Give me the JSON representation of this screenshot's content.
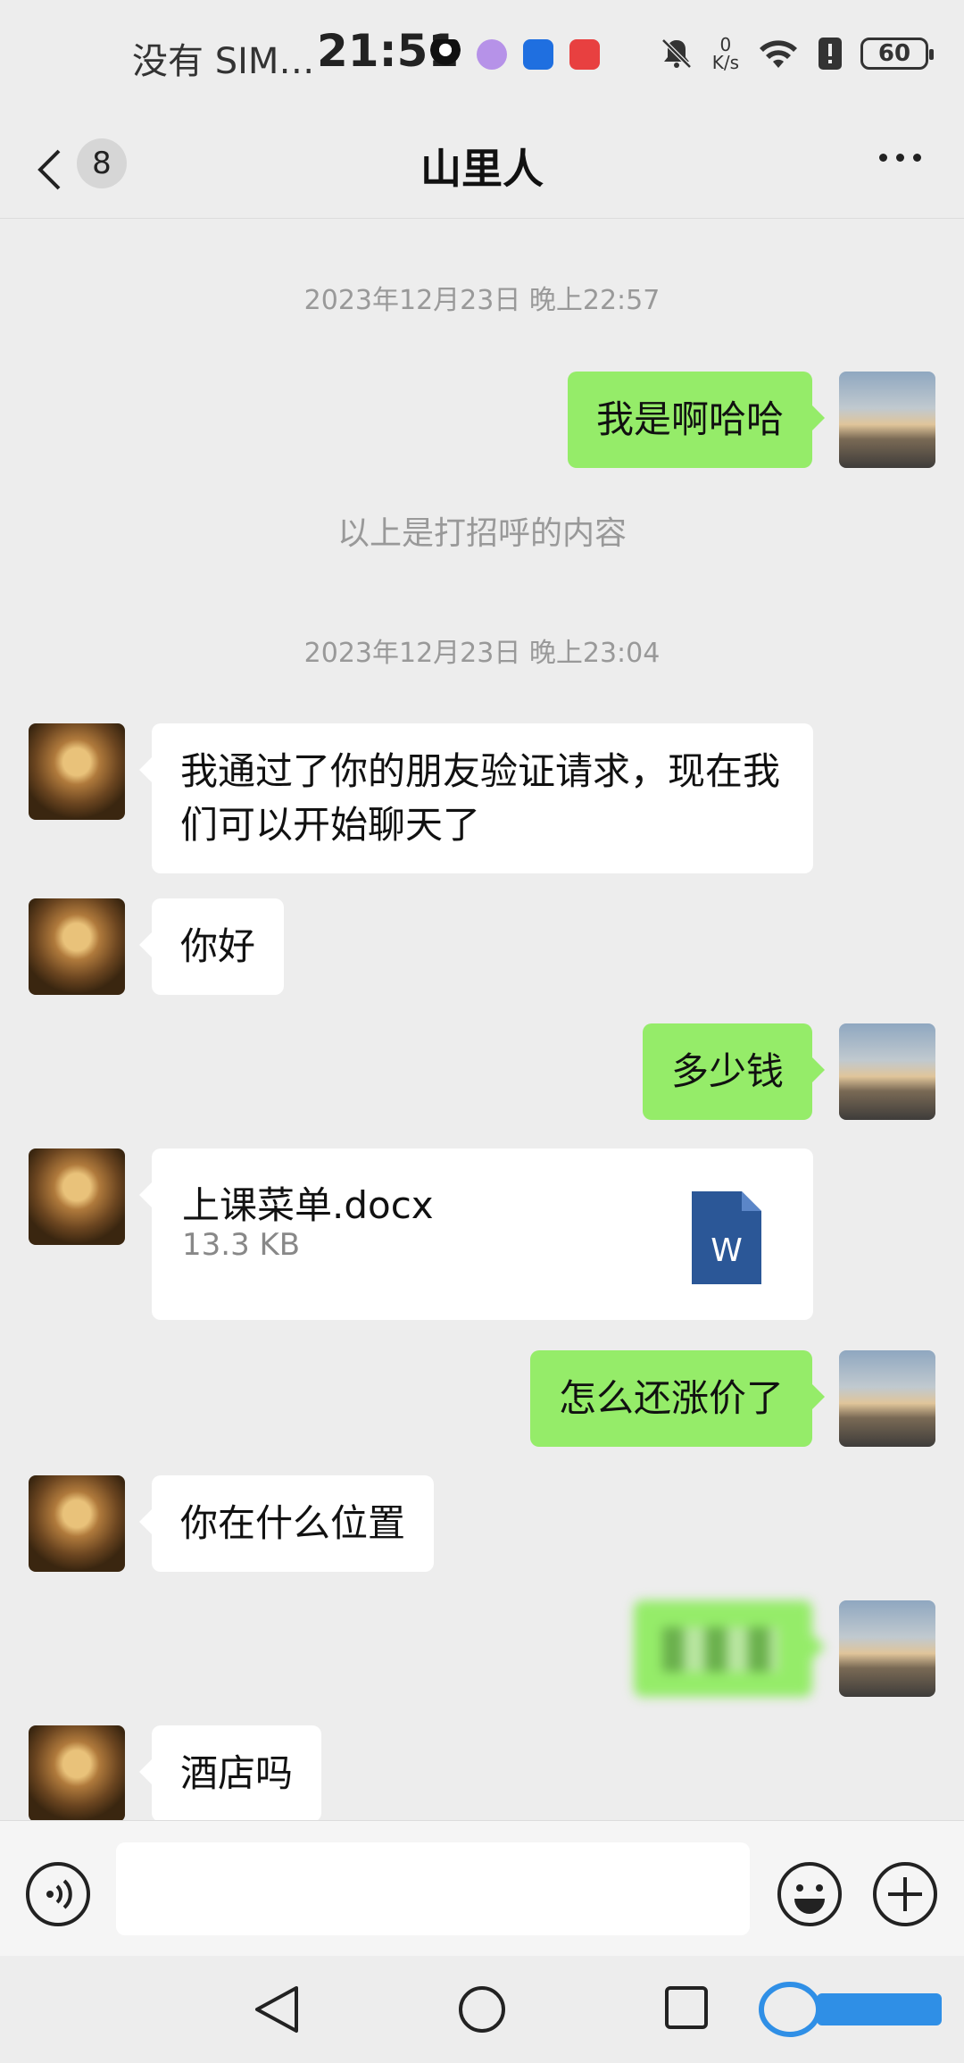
{
  "status_bar": {
    "carrier": "没有 SIM…",
    "time": "21:51",
    "net_speed_value": "0",
    "net_speed_unit": "K/s",
    "battery": "60"
  },
  "header": {
    "unread_count": "8",
    "title": "山里人"
  },
  "messages": [
    {
      "type": "timestamp",
      "text": "2023年12月23日 晚上22:57"
    },
    {
      "type": "outgoing",
      "text": "我是啊哈哈"
    },
    {
      "type": "system",
      "text": "以上是打招呼的内容"
    },
    {
      "type": "timestamp",
      "text": "2023年12月23日 晚上23:04"
    },
    {
      "type": "incoming",
      "text": "我通过了你的朋友验证请求，现在我们可以开始聊天了"
    },
    {
      "type": "incoming",
      "text": "你好"
    },
    {
      "type": "outgoing",
      "text": "多少钱"
    },
    {
      "type": "incoming_file",
      "file_name": "上课菜单.docx",
      "file_size": "13.3 KB",
      "file_icon_letter": "W"
    },
    {
      "type": "outgoing",
      "text": "怎么还涨价了"
    },
    {
      "type": "incoming",
      "text": "你在什么位置"
    },
    {
      "type": "outgoing_blurred"
    },
    {
      "type": "incoming",
      "text": "酒店吗"
    }
  ],
  "colors": {
    "outgoing_bubble": "#95ec69",
    "incoming_bubble": "#ffffff",
    "background": "#ededed",
    "word_blue": "#2b5797"
  },
  "icons": {
    "back": "chevron-left-icon",
    "more": "more-dots-icon",
    "voice": "voice-icon",
    "emoji": "emoji-icon",
    "plus": "plus-icon"
  }
}
